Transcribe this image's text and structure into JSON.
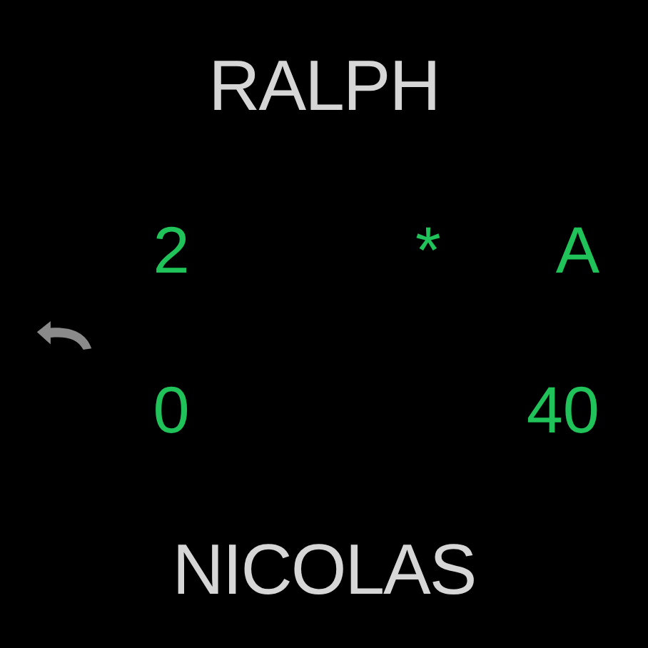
{
  "players": [
    {
      "name": "RALPH"
    },
    {
      "name": "NICOLAS"
    }
  ],
  "score_rows": [
    {
      "games": "2",
      "marker": "*",
      "points": "A"
    },
    {
      "games": "0",
      "points": "40"
    }
  ]
}
